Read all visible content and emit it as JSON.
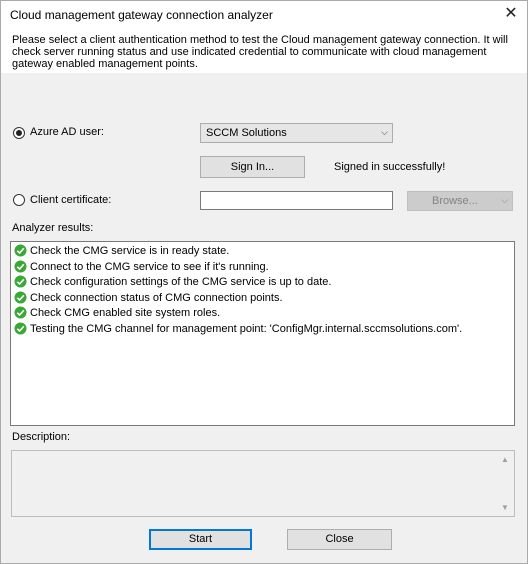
{
  "window": {
    "title": "Cloud management gateway connection analyzer",
    "close_glyph": "✕"
  },
  "intro": {
    "text": "Please select a client authentication method to test the Cloud management gateway connection. It will check server running status and use indicated credential to communicate with cloud management gateway enabled management points."
  },
  "auth": {
    "azure_label": "Azure AD user:",
    "azure_selected": true,
    "account_value": "SCCM Solutions",
    "sign_in_label": "Sign In...",
    "sign_in_status": "Signed in successfully!",
    "cert_label": "Client certificate:",
    "cert_selected": false,
    "cert_value": "",
    "browse_label": "Browse..."
  },
  "results": {
    "label": "Analyzer results:",
    "items": [
      {
        "icon": "success-check-icon",
        "text": "Check the CMG service is in ready state."
      },
      {
        "icon": "success-check-icon",
        "text": "Connect to the CMG service to see if it's running."
      },
      {
        "icon": "success-check-icon",
        "text": "Check configuration settings of the CMG service is up to date."
      },
      {
        "icon": "success-check-icon",
        "text": "Check connection status of CMG connection points."
      },
      {
        "icon": "success-check-icon",
        "text": "Check CMG enabled site system roles."
      },
      {
        "icon": "success-check-icon",
        "text": "Testing the CMG channel for management point: 'ConfigMgr.internal.sccmsolutions.com'."
      }
    ]
  },
  "description": {
    "label": "Description:",
    "value": ""
  },
  "buttons": {
    "start_label": "Start",
    "close_label": "Close"
  },
  "colors": {
    "check_green": "#3aa836",
    "default_button_border": "#0078d7"
  }
}
